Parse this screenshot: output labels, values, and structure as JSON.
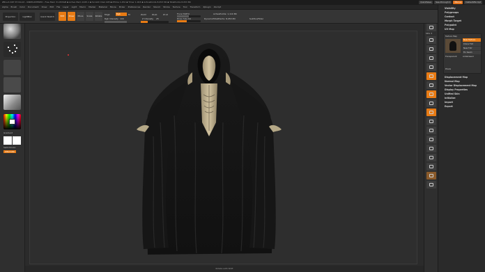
{
  "titlebar": {
    "title": "ZBrush 4R7 P3 64-bit  -  UNREGISTERED  -  Free Mem 31.653GB  ▪  Active Mem 1025.1  ▪  Scratch Disk 228  ▪  ZTime 1.452  ▪  Timer 1.003  ▪  ActivePoints 8.053 Mil  ▪  TotalPoints 8.053 Mil",
    "buttons": [
      "QuickSave",
      "See-through 0",
      "Menus",
      "DefaultZScript"
    ]
  },
  "menu": {
    "items": [
      "Alpha",
      "Brush",
      "Color",
      "Document",
      "Draw",
      "Edit",
      "File",
      "Layer",
      "Light",
      "Macro",
      "Marker",
      "Material",
      "Movie",
      "Picker",
      "Preferences",
      "Render",
      "Stencil",
      "Stroke",
      "Texture",
      "Tool",
      "Transform",
      "Zplugin",
      "Zscript"
    ]
  },
  "toolbar": {
    "projection_master": "Projection Master",
    "lightbox": "LightBox",
    "quick_sketch": "Quick Sketch",
    "edit": "Edit",
    "draw": "Draw",
    "move": "Move",
    "scale": "Scale",
    "rotate": "Rotate",
    "mrgb": "Mrgb",
    "rgb": "Rgb",
    "m": "M",
    "zadd": "Zadd",
    "zsub": "Zsub",
    "zcut": "Zcut",
    "rgb_intensity_label": "Rgb Intensity",
    "rgb_intensity_value": "100",
    "z_intensity_label": "Z Intensity",
    "z_intensity_value": "25",
    "focal_shift_label": "Focal Shift",
    "focal_shift_value": "0",
    "draw_size_label": "Draw Size",
    "draw_size_value": "64",
    "dynamic": "Dynamic",
    "active_points": "ActivePoints: 1,110 Mil",
    "total_points": "TotalPoints: 8,053 Mil",
    "subtool_count": "SubTool/Total"
  },
  "leftshelf": {
    "gradient_label": "Gradient",
    "switch_color_label": "SwitchColor",
    "alternate_label": "Alternate"
  },
  "rightshelf": {
    "labels": [
      "BPR",
      "SPix 3",
      "Scroll",
      "Zoom",
      "Actual",
      "AAHalf",
      "Persp",
      "Floor",
      "Local",
      "L.Sym",
      "Frame",
      "Move",
      "Scale",
      "Rotate",
      "Line Fill",
      "Transp",
      "Ghost",
      "Solo",
      "Xpose"
    ]
  },
  "tray": {
    "items": [
      "Visibility",
      "Polygroups",
      "Contact",
      "Morph Target",
      "Polypaint",
      "UV Map",
      "Texture Map"
    ],
    "texture_map": {
      "new_texture": "New Texture",
      "clone_txtr": "Clone Txtr",
      "new_txtr": "New Txtr",
      "fix_seam": "Fix Seam",
      "transparent": "Transparent",
      "antialiased": "Antialiased",
      "pixels": "Pixels"
    },
    "items2": [
      "Displacement Map",
      "Normal Map",
      "Vector Displacement Map",
      "Display Properties",
      "Unified Skin",
      "Initialize",
      "Import",
      "Export"
    ]
  },
  "statusbar": {
    "text": "Rotate with Shift"
  },
  "colors": {
    "accent": "#e87b14",
    "panel": "#353535",
    "background": "#2e2e2e"
  }
}
